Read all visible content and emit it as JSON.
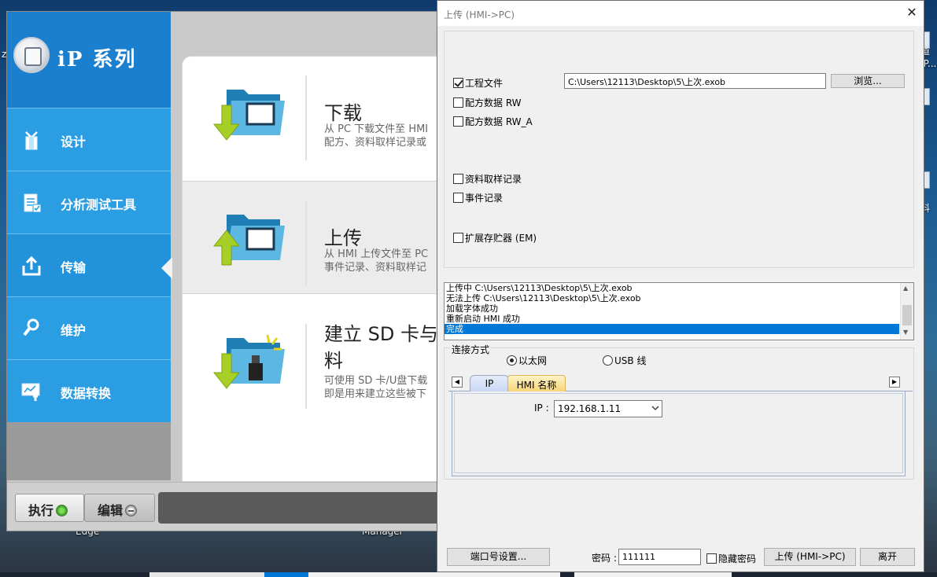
{
  "desktop": {
    "right_labels": [
      "道",
      "IP...",
      "料"
    ],
    "left_label": "z",
    "bottom_labels": [
      "Edge",
      "Manager"
    ]
  },
  "ip_app": {
    "title": "iP 系列",
    "nav": [
      {
        "label": "设计",
        "icon": "gift-icon"
      },
      {
        "label": "分析测试工具",
        "icon": "checklist-icon"
      },
      {
        "label": "传输",
        "icon": "transfer-icon"
      },
      {
        "label": "维护",
        "icon": "wrench-icon"
      },
      {
        "label": "数据转换",
        "icon": "data-convert-icon"
      }
    ],
    "active_nav": "传输",
    "cards": [
      {
        "title": "下载",
        "desc": "从 PC 下载文件至 HMI\n配方、资料取样记录或"
      },
      {
        "title": "上传",
        "desc": "从 HMI 上传文件至 PC\n事件记录、资料取样记"
      },
      {
        "title": "建立 SD 卡与\n料",
        "desc": "可使用 SD 卡/U盘下载\n即是用来建立这些被下"
      }
    ],
    "run_label": "执行",
    "edit_label": "编辑"
  },
  "dialog": {
    "title": "上传 (HMI->PC)",
    "close": "✕",
    "items": [
      {
        "label": "工程文件",
        "checked": true
      },
      {
        "label": "配方数据 RW",
        "checked": false
      },
      {
        "label": "配方数据 RW_A",
        "checked": false
      },
      {
        "label": "资料取样记录",
        "checked": false
      },
      {
        "label": "事件记录",
        "checked": false
      },
      {
        "label": "扩展存贮器 (EM)",
        "checked": false
      }
    ],
    "file_path": "C:\\Users\\12113\\Desktop\\5\\上次.exob",
    "browse_label": "浏览...",
    "log": [
      "上传中 C:\\Users\\12113\\Desktop\\5\\上次.exob",
      "无法上传 C:\\Users\\12113\\Desktop\\5\\上次.exob",
      "加载字体成功",
      "重新启动 HMI 成功",
      "完成"
    ],
    "conn_label": "连接方式",
    "conn_ethernet": "以太网",
    "conn_usb": "USB 线",
    "tab_ip": "IP",
    "tab_hmi": "HMI 名称",
    "ip_label": "IP :",
    "ip_value": "192.168.1.11",
    "port_btn": "端口号设置...",
    "pw_label": "密码 :",
    "pw_value": "111111",
    "hide_pw": "隐藏密码",
    "upload_btn": "上传 (HMI->PC)",
    "leave_btn": "离开"
  },
  "colors": {
    "nav_blue": "#2b9de2",
    "logo_blue": "#1b7fd0",
    "selection": "#0078d7"
  }
}
